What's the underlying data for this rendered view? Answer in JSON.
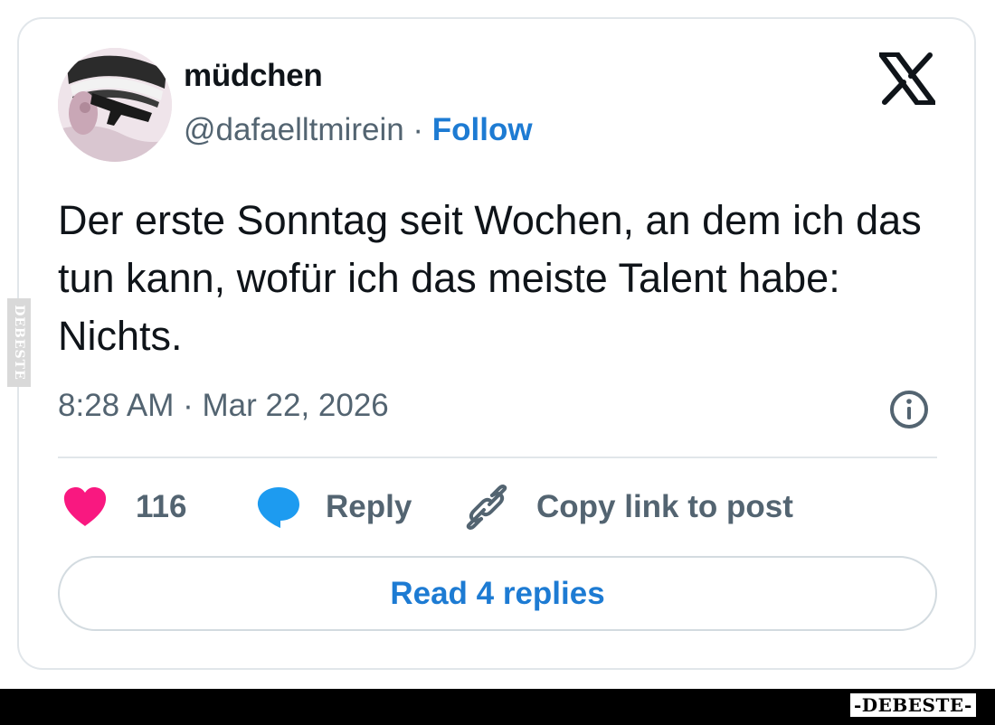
{
  "tweet": {
    "display_name": "müdchen",
    "handle": "@dafaelltmirein",
    "separator": " · ",
    "follow_label": "Follow",
    "text": "Der erste Sonntag seit Wochen, an dem ich das tun kann, wofür ich das meiste Talent habe: Nichts.",
    "timestamp": "8:28 AM · Mar 22, 2026",
    "like_count": "116",
    "reply_label": "Reply",
    "copy_link_label": "Copy link to post",
    "read_replies_label": "Read 4 replies"
  },
  "icons": {
    "brand": "x-logo-icon",
    "info": "info-icon",
    "like": "heart-icon",
    "reply": "speech-bubble-icon",
    "copy_link": "link-icon"
  },
  "colors": {
    "like": "#f91880",
    "reply": "#1d9bf0",
    "link": "#1d7bd3",
    "secondary_text": "#536471"
  },
  "watermark": {
    "side_text": "DEBESTE",
    "bottom_text": "-DEBESTE-"
  }
}
